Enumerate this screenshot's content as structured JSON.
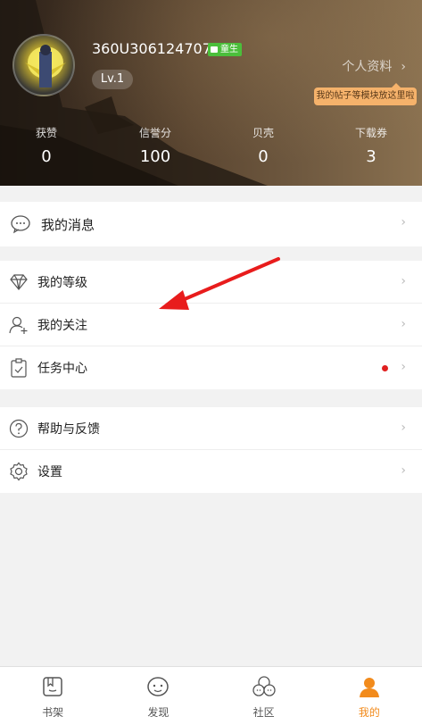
{
  "profile": {
    "username": "360U3061247078",
    "badge": "童生",
    "level": "Lv.1",
    "profile_link": "个人资料",
    "tooltip": "我的帖子等模块放这里啦"
  },
  "stats": [
    {
      "label": "获赞",
      "value": "0"
    },
    {
      "label": "信誉分",
      "value": "100"
    },
    {
      "label": "贝壳",
      "value": "0"
    },
    {
      "label": "下载券",
      "value": "3"
    }
  ],
  "menu": {
    "messages": "我的消息",
    "level": "我的等级",
    "follow": "我的关注",
    "tasks": "任务中心",
    "help": "帮助与反馈",
    "settings": "设置"
  },
  "tabs": [
    {
      "label": "书架",
      "icon": "bookshelf-icon"
    },
    {
      "label": "发现",
      "icon": "discover-icon"
    },
    {
      "label": "社区",
      "icon": "community-icon"
    },
    {
      "label": "我的",
      "icon": "me-icon"
    }
  ],
  "colors": {
    "accent": "#f28b1c",
    "dot": "#e02020",
    "badge": "#4bbf3b"
  }
}
